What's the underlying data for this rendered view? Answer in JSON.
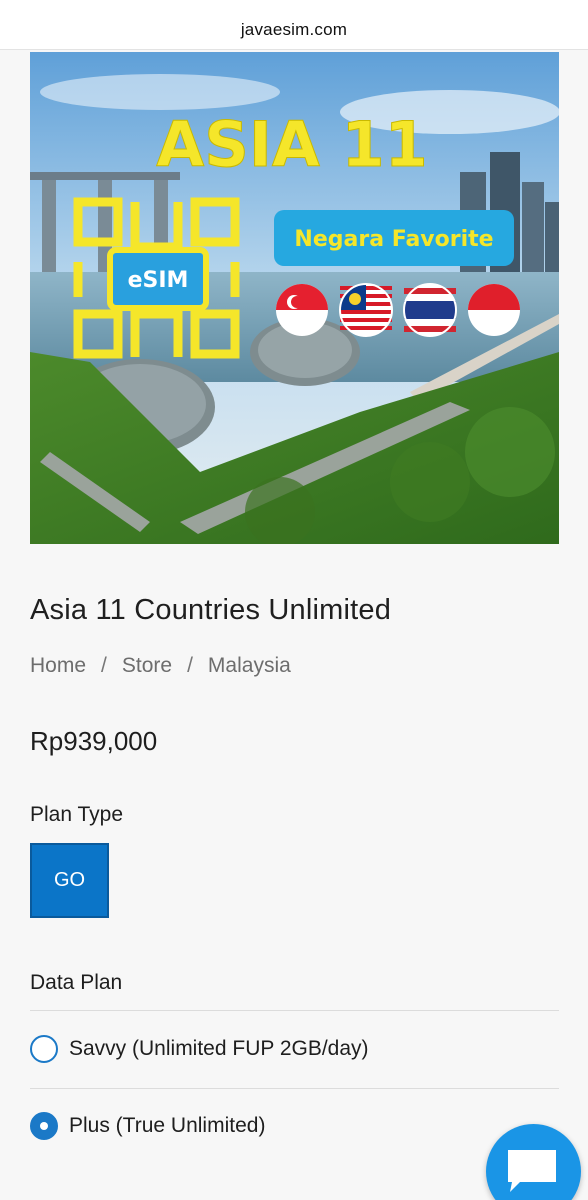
{
  "browser": {
    "url": "javaesim.com"
  },
  "hero": {
    "headline": "ASIA 11",
    "badge_text": "Negara Favorite",
    "esim_label": "eSIM",
    "flags": [
      "singapore-flag",
      "malaysia-flag",
      "thailand-flag",
      "indonesia-flag"
    ]
  },
  "product": {
    "title": "Asia 11 Countries Unlimited",
    "breadcrumb": [
      {
        "label": "Home"
      },
      {
        "label": "Store"
      },
      {
        "label": "Malaysia"
      }
    ],
    "breadcrumb_separator": "/",
    "price": "Rp939,000"
  },
  "plan_type": {
    "label": "Plan Type",
    "options": [
      {
        "label": "GO",
        "selected": true
      }
    ]
  },
  "data_plan": {
    "label": "Data Plan",
    "options": [
      {
        "label": "Savvy (Unlimited FUP 2GB/day)",
        "selected": false
      },
      {
        "label": "Plus (True Unlimited)",
        "selected": true
      }
    ]
  },
  "colors": {
    "accent": "#0b75c8",
    "radio": "#1b79c7",
    "chat_fab": "#1a95e6",
    "hero_yellow": "#f5e62a",
    "hero_badge": "#26a8e0"
  },
  "icons": {
    "chat": "chat-bubble-icon"
  }
}
